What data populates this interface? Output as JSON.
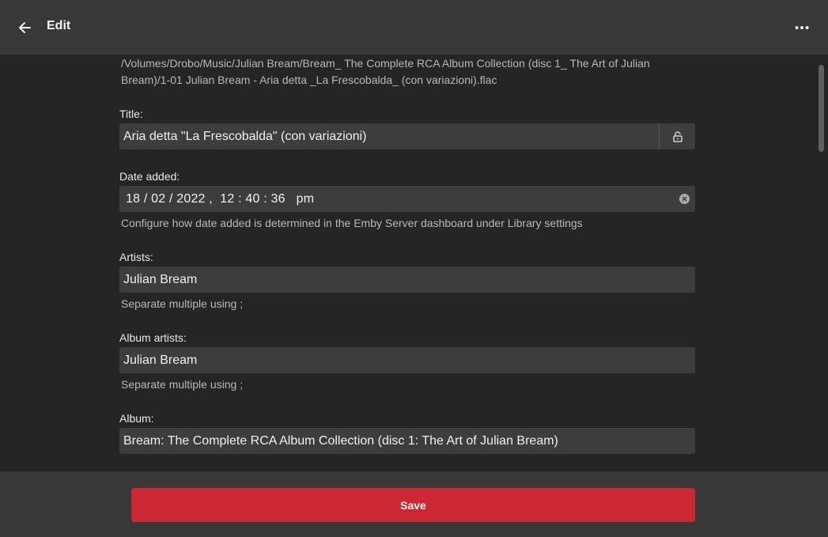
{
  "header": {
    "title": "Edit",
    "back_icon": "arrow-left-icon",
    "more_icon": "more-horizontal-icon"
  },
  "file_path": "/Volumes/Drobo/Music/Julian Bream/Bream_ The Complete RCA Album Collection (disc 1_ The Art of Julian Bream)/1-01 Julian Bream - Aria detta _La Frescobalda_ (con variazioni).flac",
  "fields": {
    "title": {
      "label": "Title:",
      "value": "Aria detta \"La Frescobalda\" (con variazioni)",
      "lock_icon": "lock-icon"
    },
    "date_added": {
      "label": "Date added:",
      "value": "18 / 02 / 2022 ,  12 : 40 : 36   pm",
      "help": "Configure how date added is determined in the Emby Server dashboard under Library settings",
      "clear_icon": "clear-icon"
    },
    "artists": {
      "label": "Artists:",
      "value": "Julian Bream",
      "help": "Separate multiple using ;"
    },
    "album_artists": {
      "label": "Album artists:",
      "value": "Julian Bream",
      "help": "Separate multiple using ;"
    },
    "album": {
      "label": "Album:",
      "value": "Bream: The Complete RCA Album Collection (disc 1: The Art of Julian Bream)"
    }
  },
  "footer": {
    "save_label": "Save"
  },
  "colors": {
    "header_bg": "#383838",
    "page_bg": "#252525",
    "field_bg": "#3d3d3d",
    "accent": "#cc2833"
  }
}
